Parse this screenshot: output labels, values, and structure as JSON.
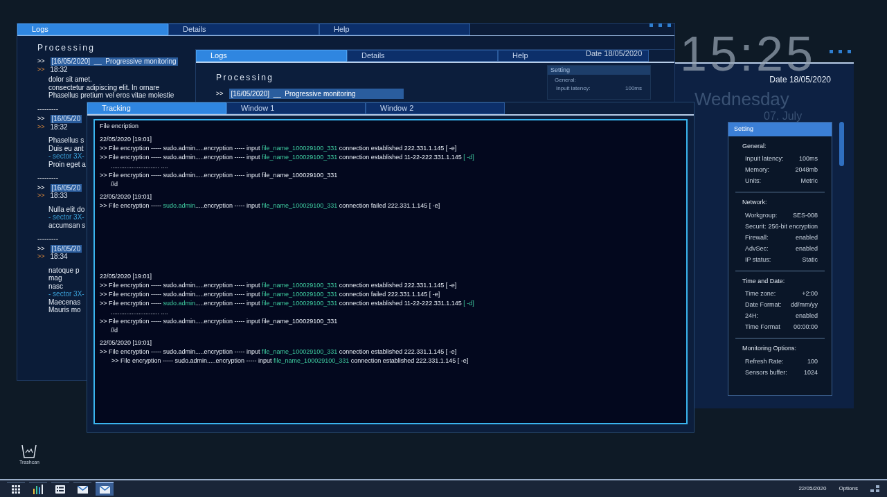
{
  "desktop": {
    "trashcan_label": "Trashcan",
    "clock": {
      "time": "15:25",
      "weekday": "Wednesday",
      "date": "07. July"
    }
  },
  "logs_window": {
    "tabs": [
      {
        "label": "Logs",
        "selected": true
      },
      {
        "label": "Details",
        "selected": false
      },
      {
        "label": "Help",
        "selected": false
      }
    ],
    "heading": "Processing",
    "entries": [
      {
        "prompt": ">>",
        "stamp": "[16/05/2020]  __  Progressive monitoring",
        "sub_prompt": ">>",
        "time": "18:32",
        "lines": [
          {
            "kind": "text",
            "text": "dolor sit amet."
          },
          {
            "kind": "text",
            "text": "consectetur adipiscing elit. In ornare"
          },
          {
            "kind": "text",
            "text": "Phasellus pretium vel eros vitae molestie"
          }
        ]
      },
      {
        "separator": "---------",
        "prompt": ">>",
        "stamp": "[16/05/20",
        "sub_prompt": ">>",
        "time": "18:32",
        "lines": [
          {
            "kind": "text",
            "text": "Phasellus s"
          },
          {
            "kind": "text",
            "text": "Duis eu ant"
          },
          {
            "kind": "sector",
            "text": "- sector 3X-"
          },
          {
            "kind": "text",
            "text": "Proin eget a"
          }
        ]
      },
      {
        "separator": "---------",
        "prompt": ">>",
        "stamp": "[16/05/20",
        "sub_prompt": ">>",
        "time": "18:33",
        "lines": [
          {
            "kind": "text",
            "text": "Nulla elit do"
          },
          {
            "kind": "sector",
            "text": "- sector 3X-"
          },
          {
            "kind": "text",
            "text": "accumsan s"
          }
        ]
      },
      {
        "separator": "---------",
        "prompt": ">>",
        "stamp": "[16/05/20",
        "sub_prompt": ">>",
        "time": "18:34",
        "lines": [
          {
            "kind": "text",
            "text": "natoque p"
          },
          {
            "kind": "text",
            "text": "mag"
          },
          {
            "kind": "text",
            "text": "nasc"
          },
          {
            "kind": "sector",
            "text": "- sector 3X-"
          },
          {
            "kind": "text",
            "text": "Maecenas"
          },
          {
            "kind": "text",
            "text": "Mauris mo"
          }
        ]
      }
    ]
  },
  "details_window": {
    "tabs": [
      {
        "label": "Logs",
        "selected": true
      },
      {
        "label": "Details",
        "selected": false
      },
      {
        "label": "Help",
        "selected": false
      }
    ],
    "date": "Date 18/05/2020",
    "heading": "Processing",
    "entry": {
      "prompt": ">>",
      "stamp": "[16/05/2020]  __  Progressive monitoring"
    },
    "setting_title": "Setting",
    "setting_group": "General:",
    "setting_label": "Inpuit latency:",
    "setting_value": "100ms"
  },
  "settings_window": {
    "date": "Date 18/05/2020",
    "title": "Setting",
    "groups": [
      {
        "heading": "General:",
        "rows": [
          {
            "label": "Inpuit latency:",
            "value": "100ms"
          },
          {
            "label": "Memory:",
            "value": "2048mb"
          },
          {
            "label": "Units:",
            "value": "Metric"
          }
        ]
      },
      {
        "heading": "Network:",
        "rows": [
          {
            "label": "Workgroup:",
            "value": "SES-008"
          },
          {
            "label": "Securit:",
            "value": "256-bit encryption"
          },
          {
            "label": "Firewall:",
            "value": "enabled"
          },
          {
            "label": "AdvSec:",
            "value": "enabled"
          },
          {
            "label": "IP status:",
            "value": "Static"
          }
        ]
      },
      {
        "heading": "Time and Date:",
        "rows": [
          {
            "label": "Time zone:",
            "value": "+2:00"
          },
          {
            "label": "Date Format:",
            "value": "dd/mm/yy"
          },
          {
            "label": "24H:",
            "value": "enabled"
          },
          {
            "label": "Time Format",
            "value": "00:00:00"
          }
        ]
      },
      {
        "heading": "Monitoring Options:",
        "rows": [
          {
            "label": "Refresh Rate:",
            "value": "100"
          },
          {
            "label": "Sensors buffer:",
            "value": "1024"
          }
        ]
      }
    ]
  },
  "tracking_window": {
    "tabs": [
      {
        "label": "Tracking",
        "selected": true
      },
      {
        "label": "Window 1",
        "selected": false
      },
      {
        "label": "Window 2",
        "selected": false
      }
    ],
    "console": {
      "title": "File encription",
      "sections": [
        {
          "blocks": [
            {
              "date": "22/05/2020 [19:01]",
              "lines": [
                {
                  "kind": "cmd",
                  "segments": [
                    {
                      "text": ">> File encryption ----- sudo.admin.....encryption ----- input ",
                      "highlight": false
                    },
                    {
                      "text": "file_name_100029100_331",
                      "highlight": true
                    },
                    {
                      "text": " connection established 222.331.1.145 [ -e]",
                      "highlight": false
                    }
                  ]
                },
                {
                  "kind": "cmd",
                  "segments": [
                    {
                      "text": ">> File encryption ----- sudo.admin.....encryption ----- input ",
                      "highlight": false
                    },
                    {
                      "text": "file_name_100029100_331",
                      "highlight": true
                    },
                    {
                      "text": " connection established 11-22-222.331.1.145 ",
                      "highlight": false
                    },
                    {
                      "text": "[ -d]",
                      "highlight": true
                    }
                  ]
                },
                {
                  "kind": "dots",
                  "segments": [
                    {
                      "text": "............................ ....",
                      "highlight": false
                    }
                  ]
                },
                {
                  "kind": "cmd",
                  "segments": [
                    {
                      "text": ">> File encryption ----- sudo.admin.....encryption ----- input file_name_100029100_331",
                      "highlight": false
                    }
                  ]
                },
                {
                  "kind": "note",
                  "segments": [
                    {
                      "text": "//d",
                      "highlight": false
                    }
                  ]
                }
              ]
            },
            {
              "date": "22/05/2020 [19:01]",
              "lines": [
                {
                  "kind": "cmd",
                  "segments": [
                    {
                      "text": ">> File encryption ----- ",
                      "highlight": false
                    },
                    {
                      "text": "sudo.admin",
                      "highlight": true
                    },
                    {
                      "text": ".....encryption ----- input ",
                      "highlight": false
                    },
                    {
                      "text": "file_name_100029100_331",
                      "highlight": true
                    },
                    {
                      "text": " connection failed 222.331.1.145 [ -e]",
                      "highlight": false
                    }
                  ]
                }
              ]
            }
          ]
        },
        {
          "blocks": [
            {
              "date": "22/05/2020 [19:01]",
              "lines": [
                {
                  "kind": "cmd",
                  "segments": [
                    {
                      "text": ">> File encryption ----- sudo.admin.....encryption ----- input ",
                      "highlight": false
                    },
                    {
                      "text": "file_name_100029100_331",
                      "highlight": true
                    },
                    {
                      "text": " connection established 222.331.1.145 [ -e]",
                      "highlight": false
                    }
                  ]
                },
                {
                  "kind": "cmd",
                  "segments": [
                    {
                      "text": ">> File encryption ----- sudo.admin.....encryption ----- input ",
                      "highlight": false
                    },
                    {
                      "text": "file_name_100029100_331",
                      "highlight": true
                    },
                    {
                      "text": " connection failed 222.331.1.145 [ -e]",
                      "highlight": false
                    }
                  ]
                },
                {
                  "kind": "cmd",
                  "segments": [
                    {
                      "text": ">> File encryption ----- ",
                      "highlight": false
                    },
                    {
                      "text": "sudo.admin",
                      "highlight": true
                    },
                    {
                      "text": ".....encryption ----- input ",
                      "highlight": false
                    },
                    {
                      "text": "file_name_100029100_331",
                      "highlight": true
                    },
                    {
                      "text": " connection established 11-22-222.331.1.145 ",
                      "highlight": false
                    },
                    {
                      "text": "[ -d]",
                      "highlight": true
                    }
                  ]
                },
                {
                  "kind": "dots",
                  "segments": [
                    {
                      "text": "............................ ....",
                      "highlight": false
                    }
                  ]
                },
                {
                  "kind": "cmd",
                  "segments": [
                    {
                      "text": ">> File encryption ----- sudo.admin.....encryption ----- input file_name_100029100_331",
                      "highlight": false
                    }
                  ]
                },
                {
                  "kind": "note",
                  "segments": [
                    {
                      "text": "//d",
                      "highlight": false
                    }
                  ]
                }
              ]
            },
            {
              "date": "22/05/2020 [19:01]",
              "lines": [
                {
                  "kind": "cmd",
                  "segments": [
                    {
                      "text": ">> File encryption ----- sudo.admin.....encryption ----- input ",
                      "highlight": false
                    },
                    {
                      "text": "file_name_100029100_331",
                      "highlight": true
                    },
                    {
                      "text": " connection established 222.331.1.145 [ -e]",
                      "highlight": false
                    }
                  ]
                },
                {
                  "kind": "sub_cmd",
                  "segments": [
                    {
                      "text": ">> File encryption ----- sudo.admin.....encryption ----- input ",
                      "highlight": false
                    },
                    {
                      "text": "file_name_100029100_331",
                      "highlight": true
                    },
                    {
                      "text": " connection established 222.331.1.145 [ -e]",
                      "highlight": false
                    }
                  ]
                }
              ]
            }
          ]
        }
      ]
    }
  },
  "taskbar": {
    "apps": [
      {
        "kind": "apps",
        "selected": false
      },
      {
        "kind": "chart",
        "selected": false
      },
      {
        "kind": "list",
        "selected": false
      },
      {
        "kind": "mail",
        "selected": false
      },
      {
        "kind": "mail",
        "selected": true
      }
    ],
    "date": "22/05/2020",
    "options": "Options"
  }
}
